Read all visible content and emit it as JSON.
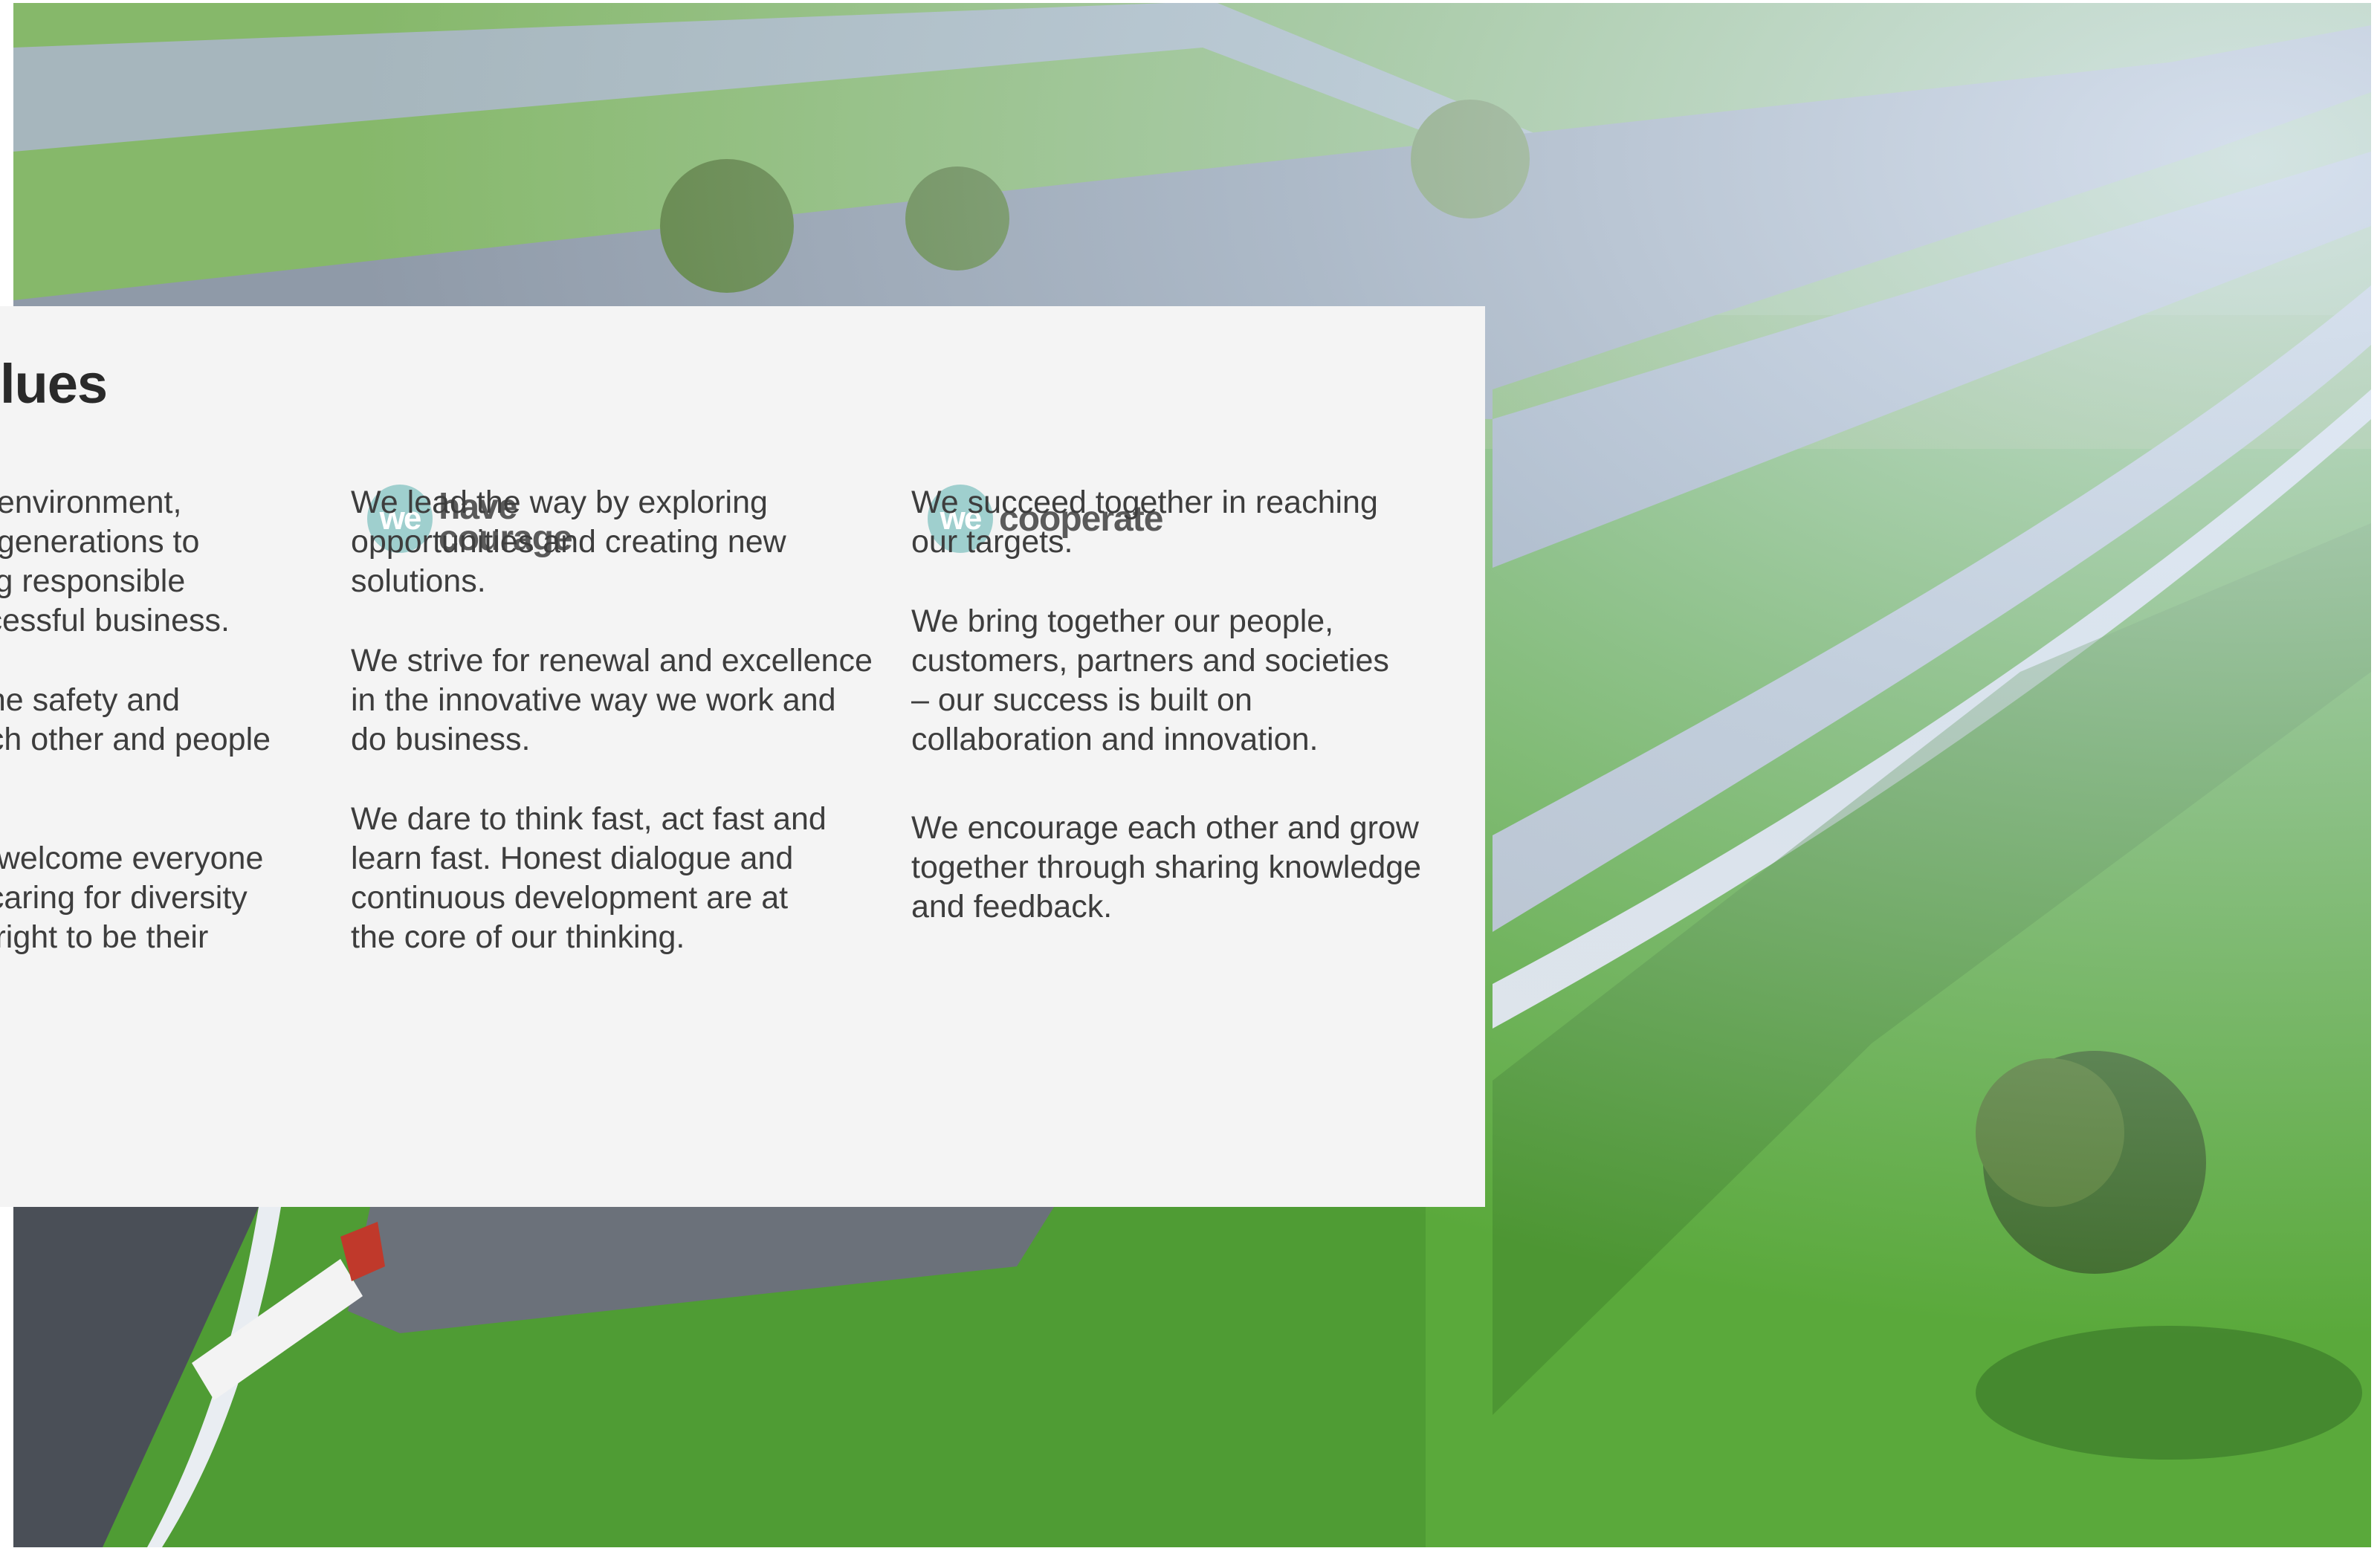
{
  "panel": {
    "title_fragment": "lues"
  },
  "columns": [
    {
      "paragraphs": [
        "e environment,\ne generations to\ning responsible\nccessful business.",
        " the safety and\nach other and people\n ",
        "d welcome everyone\n, caring for diversity\ns right to be their\ns."
      ]
    },
    {
      "logo": {
        "mark": "we",
        "text_line1": "have",
        "text_line2": "courage"
      },
      "paragraphs": [
        "We lead the way by exploring\nopportunities and creating new\nsolutions.",
        "We strive for renewal and excellence\nin the innovative way we work and\ndo business.",
        "We dare to think fast, act fast and\nlearn fast. Honest dialogue and\ncontinuous development are at\nthe core of our thinking."
      ]
    },
    {
      "logo": {
        "mark": "we",
        "text_line1": "cooperate",
        "text_line2": ""
      },
      "paragraphs": [
        "We succeed together in reaching\nour targets.",
        "We bring together our people,\ncustomers, partners and societies\n– our success is built on\ncollaboration and innovation.",
        "We encourage each other and grow\ntogether through sharing knowledge\nand feedback."
      ]
    }
  ],
  "colors": {
    "panel_bg": "#f4f4f4",
    "logo_accent": "#9fcfce",
    "text": "#3d3d3d"
  }
}
